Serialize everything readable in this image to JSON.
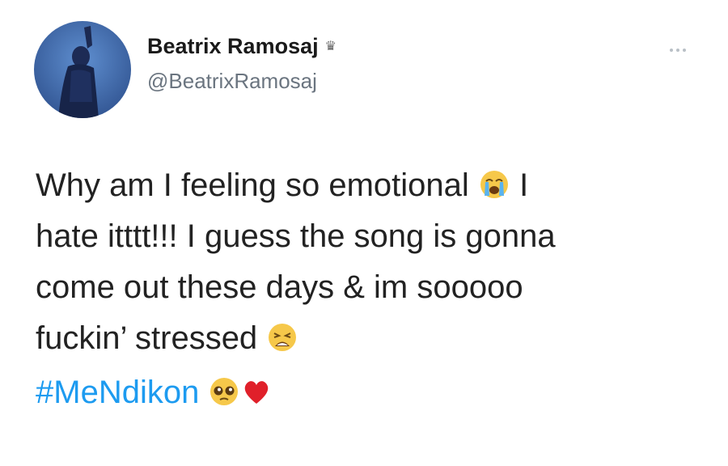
{
  "user": {
    "display_name": "Beatrix Ramosaj",
    "handle": "@BeatrixRamosaj",
    "badge_icon": "crown-icon",
    "avatar_icon": "profile-photo"
  },
  "menu": {
    "icon": "more-options-icon"
  },
  "tweet": {
    "line1": "Why am I feeling so emotional",
    "line1_tail": "I",
    "line2": "hate itttt!!! I guess the song is gonna",
    "line3": "come out these days & im sooooo",
    "line4": "fuckin’ stressed",
    "hashtag": "#MeNdikon",
    "emojis": [
      "loudly-crying-face",
      "weary-face",
      "pleading-face",
      "red-heart"
    ]
  },
  "colors": {
    "hashtag": "#1d9bf0",
    "handle": "#6b7580",
    "text": "#222222"
  }
}
